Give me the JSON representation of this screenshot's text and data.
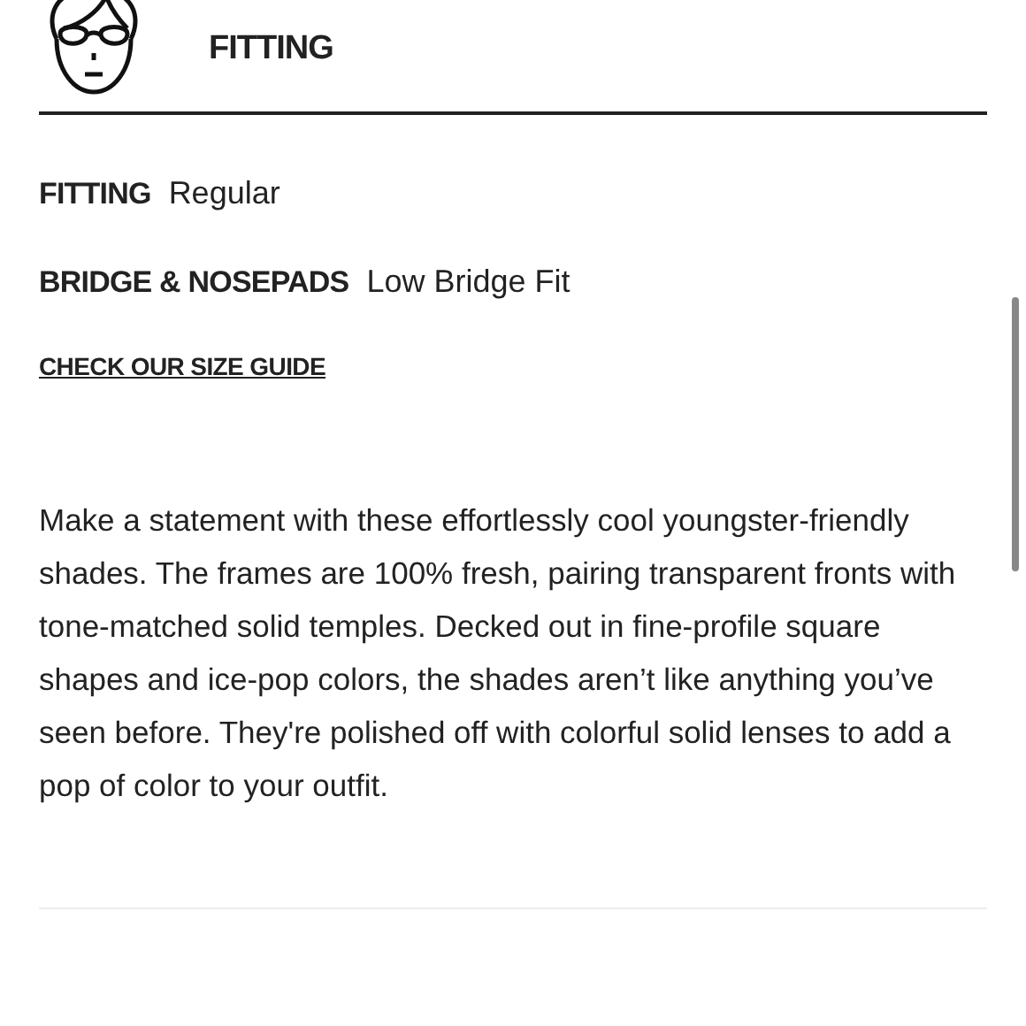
{
  "header": {
    "title": "FITTING"
  },
  "specs": [
    {
      "label": "FITTING",
      "value": "Regular"
    },
    {
      "label": "BRIDGE & NOSEPADS",
      "value": "Low Bridge Fit"
    }
  ],
  "size_guide_link": "CHECK OUR SIZE GUIDE",
  "description": "Make a statement with these effortlessly cool youngster-friendly shades. The frames are 100% fresh, pairing transparent fronts with tone-matched solid temples. Decked out in fine-profile square shapes and ice-pop colors, the shades aren’t like anything you’ve seen before. They're polished off with colorful solid lenses to add a pop of color to your outfit."
}
